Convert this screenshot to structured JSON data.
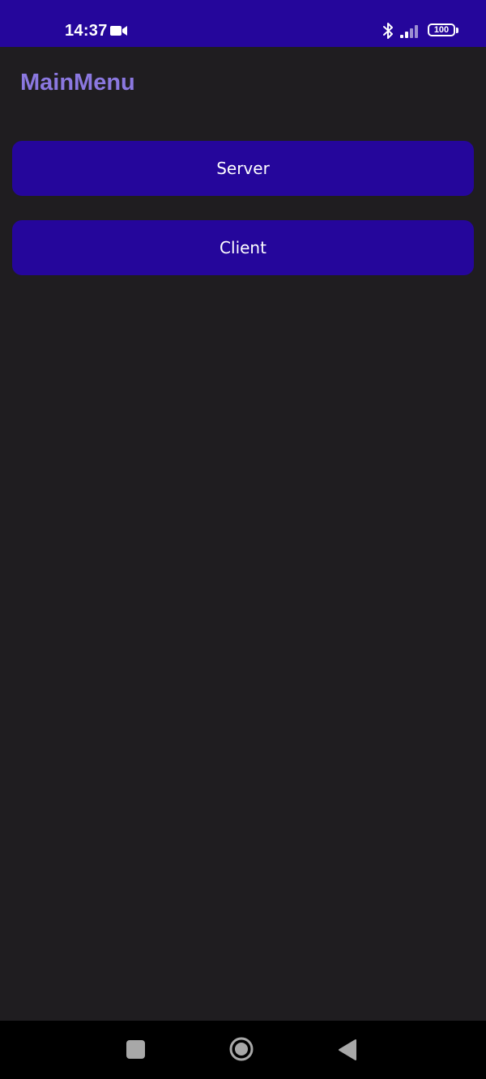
{
  "status_bar": {
    "time": "14:37",
    "battery_level": "100",
    "icons": [
      "video-icon",
      "bluetooth-icon",
      "signal-icon",
      "battery-icon"
    ]
  },
  "app": {
    "title": "MainMenu"
  },
  "menu": {
    "server_label": "Server",
    "client_label": "Client"
  },
  "nav_bar": {
    "icons": [
      "recents-icon",
      "home-icon",
      "back-icon"
    ]
  },
  "colors": {
    "primary": "#25069b",
    "title_accent": "#8b78e0",
    "background": "#1f1d20",
    "nav_background": "#000000"
  }
}
